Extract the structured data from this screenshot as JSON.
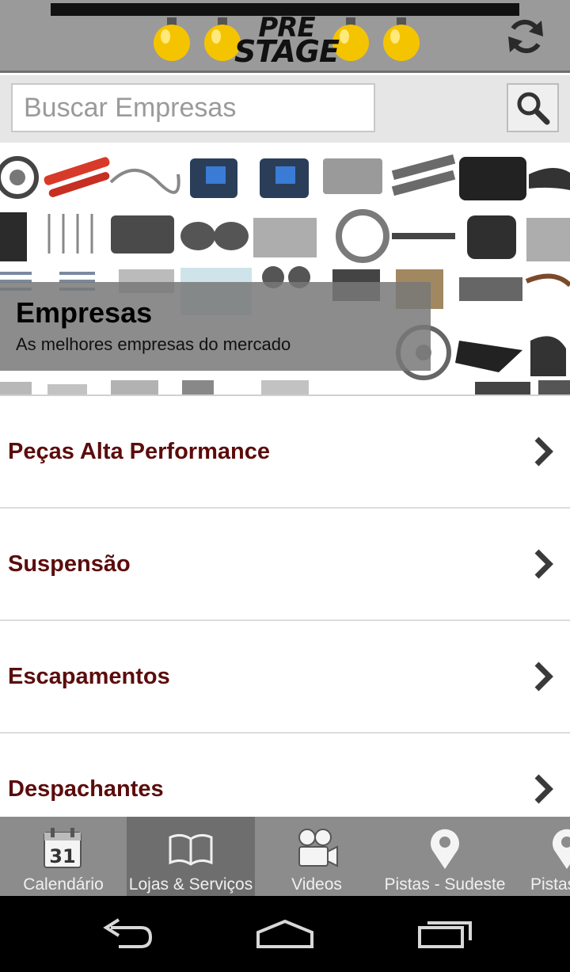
{
  "header": {
    "logo_text_line1": "PRE",
    "logo_text_line2": "STAGE",
    "refresh_icon": "refresh-icon"
  },
  "search": {
    "placeholder": "Buscar Empresas",
    "value": "",
    "button_icon": "search-icon"
  },
  "banner": {
    "title": "Empresas",
    "subtitle": "As melhores empresas do mercado"
  },
  "categories": [
    {
      "label": "Peças Alta Performance"
    },
    {
      "label": "Suspensão"
    },
    {
      "label": "Escapamentos"
    },
    {
      "label": "Despachantes"
    }
  ],
  "tabs": [
    {
      "label": "Calendário",
      "icon": "calendar-icon",
      "icon_text": "31",
      "active": false
    },
    {
      "label": "Lojas & Serviços",
      "icon": "book-icon",
      "active": true
    },
    {
      "label": "Videos",
      "icon": "video-camera-icon",
      "active": false
    },
    {
      "label": "Pistas - Sudeste",
      "icon": "map-pin-icon",
      "active": false
    },
    {
      "label": "Pistas",
      "icon": "map-pin-icon",
      "active": false
    }
  ],
  "system_nav": {
    "back_icon": "back-icon",
    "home_icon": "home-icon",
    "recents_icon": "recent-apps-icon"
  },
  "colors": {
    "header_bg": "#9a9a9a",
    "category_text": "#5c0c0c",
    "tabbar_bg": "#8c8c8c",
    "tab_active_bg": "#6e6e6e"
  }
}
